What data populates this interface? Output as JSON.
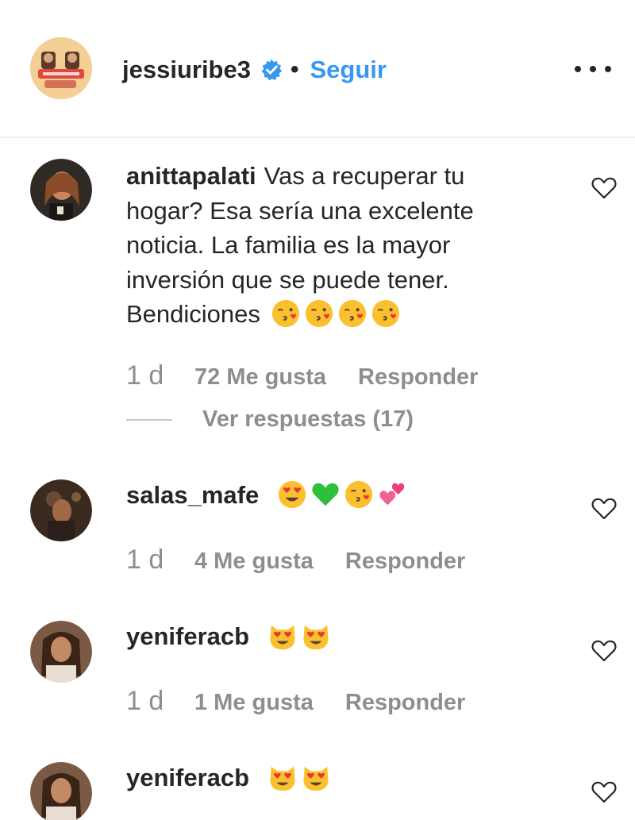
{
  "header": {
    "username": "jessiuribe3",
    "separator": "•",
    "follow_label": "Seguir",
    "verified_icon": "verified-badge-icon",
    "more_icon": "more-options-icon"
  },
  "comments": [
    {
      "username": "anittapalati",
      "text": "Vas a recuperar tu hogar? Esa sería una excelente noticia. La familia es la mayor inversión que se puede tener. Bendiciones",
      "emojis": [
        "kissing-heart-emoji",
        "kissing-heart-emoji",
        "kissing-heart-emoji",
        "kissing-heart-emoji"
      ],
      "age": "1 d",
      "likes": "72 Me gusta",
      "reply_label": "Responder",
      "view_replies": "Ver respuestas (17)"
    },
    {
      "username": "salas_mafe",
      "text": "",
      "emojis": [
        "heart-eyes-emoji",
        "green-heart-emoji",
        "kissing-heart-emoji",
        "two-hearts-emoji"
      ],
      "age": "1 d",
      "likes": "4 Me gusta",
      "reply_label": "Responder"
    },
    {
      "username": "yeniferacb",
      "text": "",
      "emojis": [
        "heart-eyes-cat-emoji",
        "heart-eyes-cat-emoji"
      ],
      "age": "1 d",
      "likes": "1 Me gusta",
      "reply_label": "Responder"
    },
    {
      "username": "yeniferacb",
      "text": "",
      "emojis": [
        "heart-eyes-cat-emoji",
        "heart-eyes-cat-emoji"
      ]
    }
  ],
  "colors": {
    "link_blue": "#3897f0",
    "text": "#262626",
    "muted": "#8e8e8e",
    "divider": "#efefef"
  }
}
